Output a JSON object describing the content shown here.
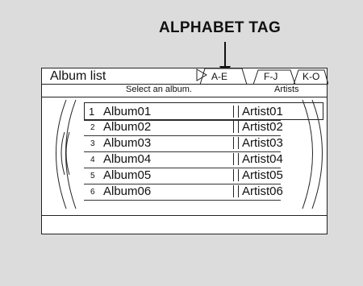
{
  "callout": {
    "label": "ALPHABET TAG"
  },
  "screen": {
    "title": "Album list",
    "tabs": [
      "A-E",
      "F-J",
      "K-O"
    ],
    "header": {
      "instruction": "Select an album.",
      "artists_label": "Artists"
    },
    "rows": [
      {
        "num": "1",
        "album": "Album01",
        "artist": "Artist01"
      },
      {
        "num": "2",
        "album": "Album02",
        "artist": "Artist02"
      },
      {
        "num": "3",
        "album": "Album03",
        "artist": "Artist03"
      },
      {
        "num": "4",
        "album": "Album04",
        "artist": "Artist04"
      },
      {
        "num": "5",
        "album": "Album05",
        "artist": "Artist05"
      },
      {
        "num": "6",
        "album": "Album06",
        "artist": "Artist06"
      }
    ]
  }
}
